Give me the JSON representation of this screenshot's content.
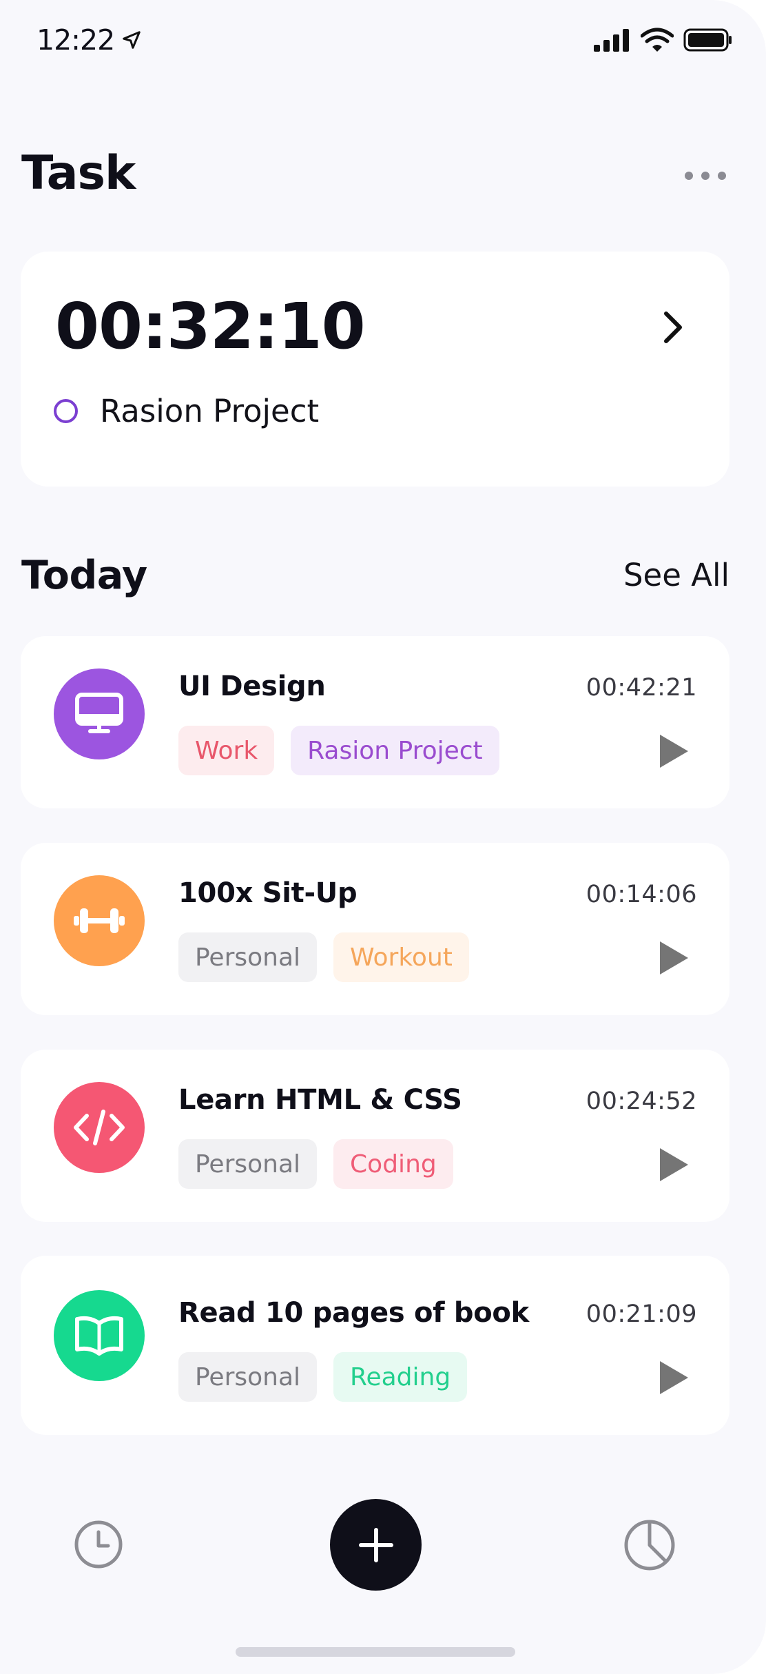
{
  "status_bar": {
    "time": "12:22"
  },
  "header": {
    "title": "Task"
  },
  "timer": {
    "value": "00:32:10",
    "project": "Rasion Project",
    "project_color": "#7b3fd1"
  },
  "today": {
    "title": "Today",
    "see_all": "See All"
  },
  "tasks": [
    {
      "title": "UI Design",
      "time": "00:42:21",
      "icon": "monitor-icon",
      "color": "#9c55e0",
      "tags": [
        {
          "label": "Work",
          "text_color": "#e8576b",
          "bg_color": "#fdecee"
        },
        {
          "label": "Rasion Project",
          "text_color": "#9a4ccf",
          "bg_color": "#f3ebfb"
        }
      ]
    },
    {
      "title": "100x Sit-Up",
      "time": "00:14:06",
      "icon": "dumbbell-icon",
      "color": "#ffa14f",
      "tags": [
        {
          "label": "Personal",
          "text_color": "#7a7a80",
          "bg_color": "#f1f1f3"
        },
        {
          "label": "Workout",
          "text_color": "#f5a65b",
          "bg_color": "#fff4ea"
        }
      ]
    },
    {
      "title": "Learn HTML & CSS",
      "time": "00:24:52",
      "icon": "code-icon",
      "color": "#f55773",
      "tags": [
        {
          "label": "Personal",
          "text_color": "#7a7a80",
          "bg_color": "#f1f1f3"
        },
        {
          "label": "Coding",
          "text_color": "#ef5d77",
          "bg_color": "#fdecef"
        }
      ]
    },
    {
      "title": "Read 10 pages of book",
      "time": "00:21:09",
      "icon": "book-icon",
      "color": "#16d98f",
      "tags": [
        {
          "label": "Personal",
          "text_color": "#7a7a80",
          "bg_color": "#f1f1f3"
        },
        {
          "label": "Reading",
          "text_color": "#22cf8d",
          "bg_color": "#e7faf2"
        }
      ]
    }
  ],
  "bottom_nav": {
    "items": [
      "clock-icon",
      "add-icon",
      "pie-chart-icon"
    ]
  }
}
